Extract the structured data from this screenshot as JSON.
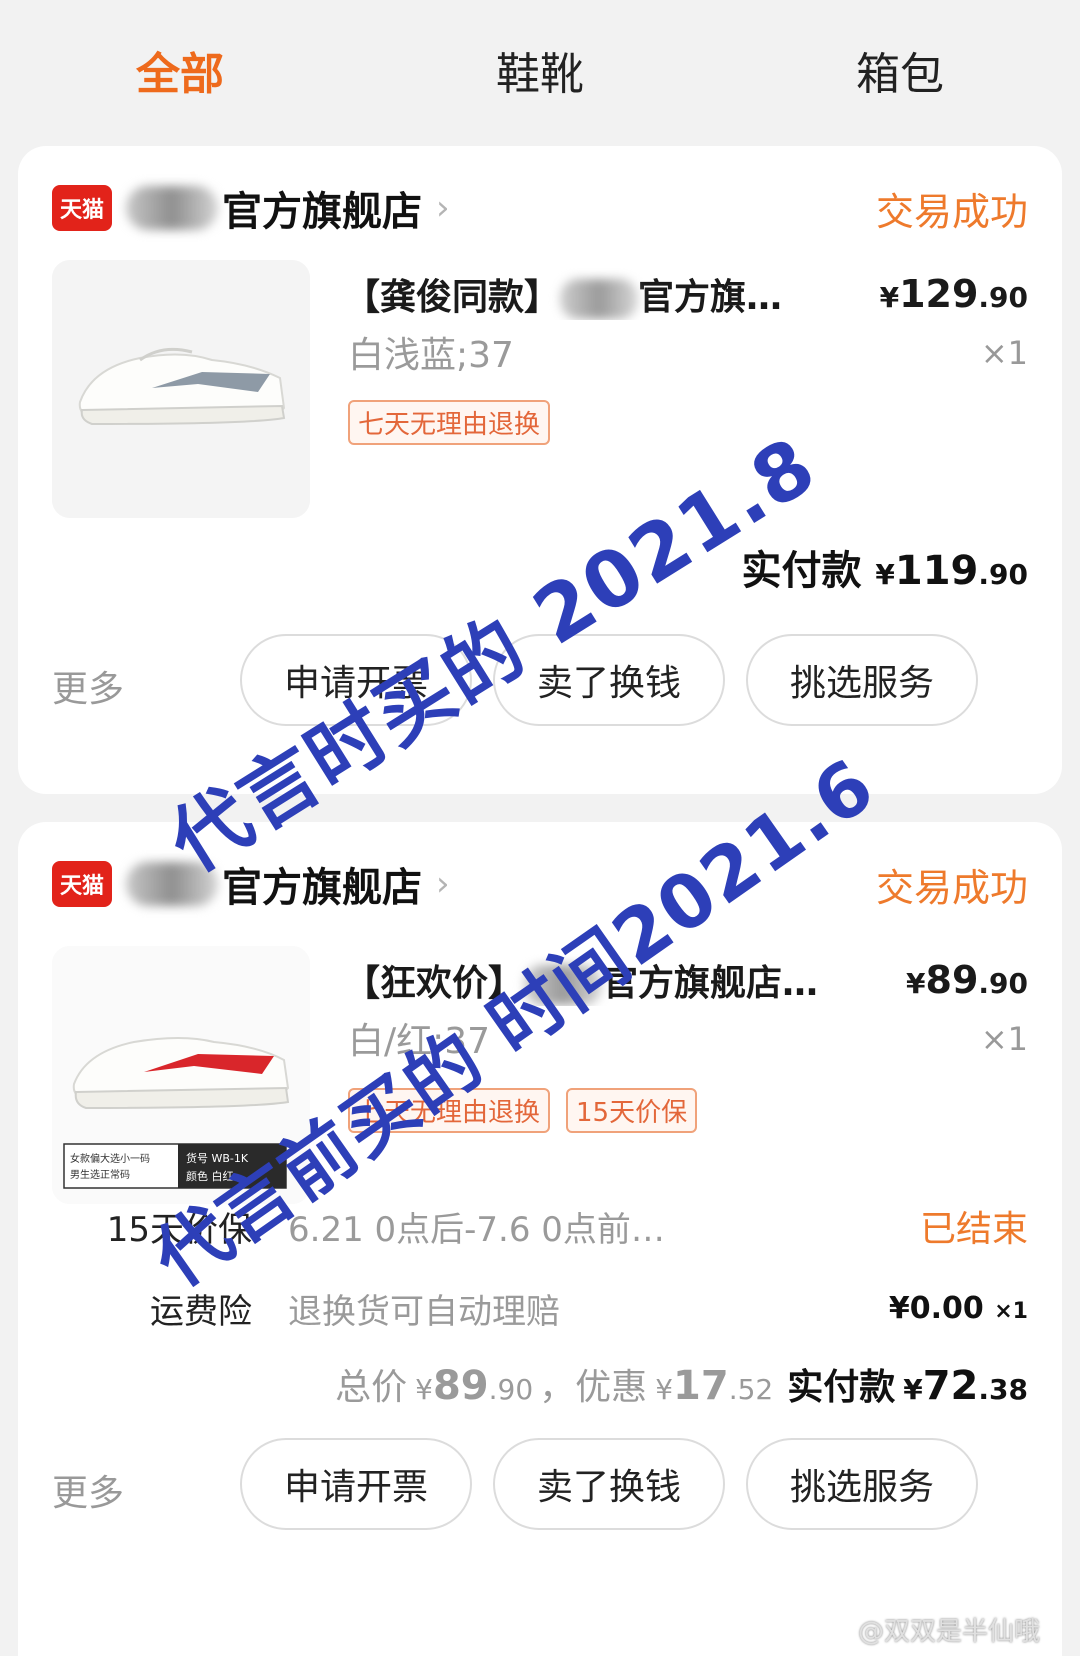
{
  "tabs": [
    {
      "label": "全部",
      "active": true
    },
    {
      "label": "鞋靴",
      "active": false
    },
    {
      "label": "箱包",
      "active": false
    }
  ],
  "orders": [
    {
      "shop_badge": "天猫",
      "shop_name": "官方旗舰店",
      "status": "交易成功",
      "product": {
        "title": "【龚俊同款】",
        "title_suffix": "官方旗…",
        "price_cur": "¥",
        "price_int": "129",
        "price_dec": ".90",
        "sku": "白浅蓝;37",
        "qty": "×1",
        "tags": [
          "七天无理由退换"
        ],
        "shoe_color": "#8e9aa6"
      },
      "paid_label": "实付款",
      "paid_cur": "¥",
      "paid_int": "119",
      "paid_dec": ".90",
      "more": "更多",
      "buttons": [
        "申请开票",
        "卖了换钱",
        "挑选服务"
      ]
    },
    {
      "shop_badge": "天猫",
      "shop_name": "官方旗舰店",
      "status": "交易成功",
      "product": {
        "title": "【狂欢价】",
        "title_suffix": "官方旗舰店…",
        "price_cur": "¥",
        "price_int": "89",
        "price_dec": ".90",
        "sku": "白/红;37",
        "qty": "×1",
        "tags": [
          "七天无理由退换",
          "15天价保"
        ],
        "shoe_color": "#d9262b",
        "thumb_caption_left": "女款偏大选小一码\n男生选正常码",
        "thumb_caption_right": "货号 WB-1K\n颜色 白红"
      },
      "services": [
        {
          "label": "15天价保",
          "desc": "6.21 0点后-7.6 0点前…",
          "end": "已结束"
        },
        {
          "label": "运费险",
          "desc": "退换货可自动理赔",
          "amount": "¥0.00",
          "amount_qty": "×1"
        }
      ],
      "total_label": "总价",
      "total_cur": "¥",
      "total_int": "89",
      "total_dec": ".90",
      "discount_label": "，优惠",
      "discount_cur": "¥",
      "discount_int": "17",
      "discount_dec": ".52",
      "paid_label": "实付款",
      "paid_cur": "¥",
      "paid_int": "72",
      "paid_dec": ".38",
      "more": "更多",
      "buttons": [
        "申请开票",
        "卖了换钱",
        "挑选服务"
      ]
    }
  ],
  "overlays": [
    "代言时买的 2021.8",
    "代言前买的 时间2021.6"
  ],
  "weibo_watermark": "@双双是半仙哦"
}
